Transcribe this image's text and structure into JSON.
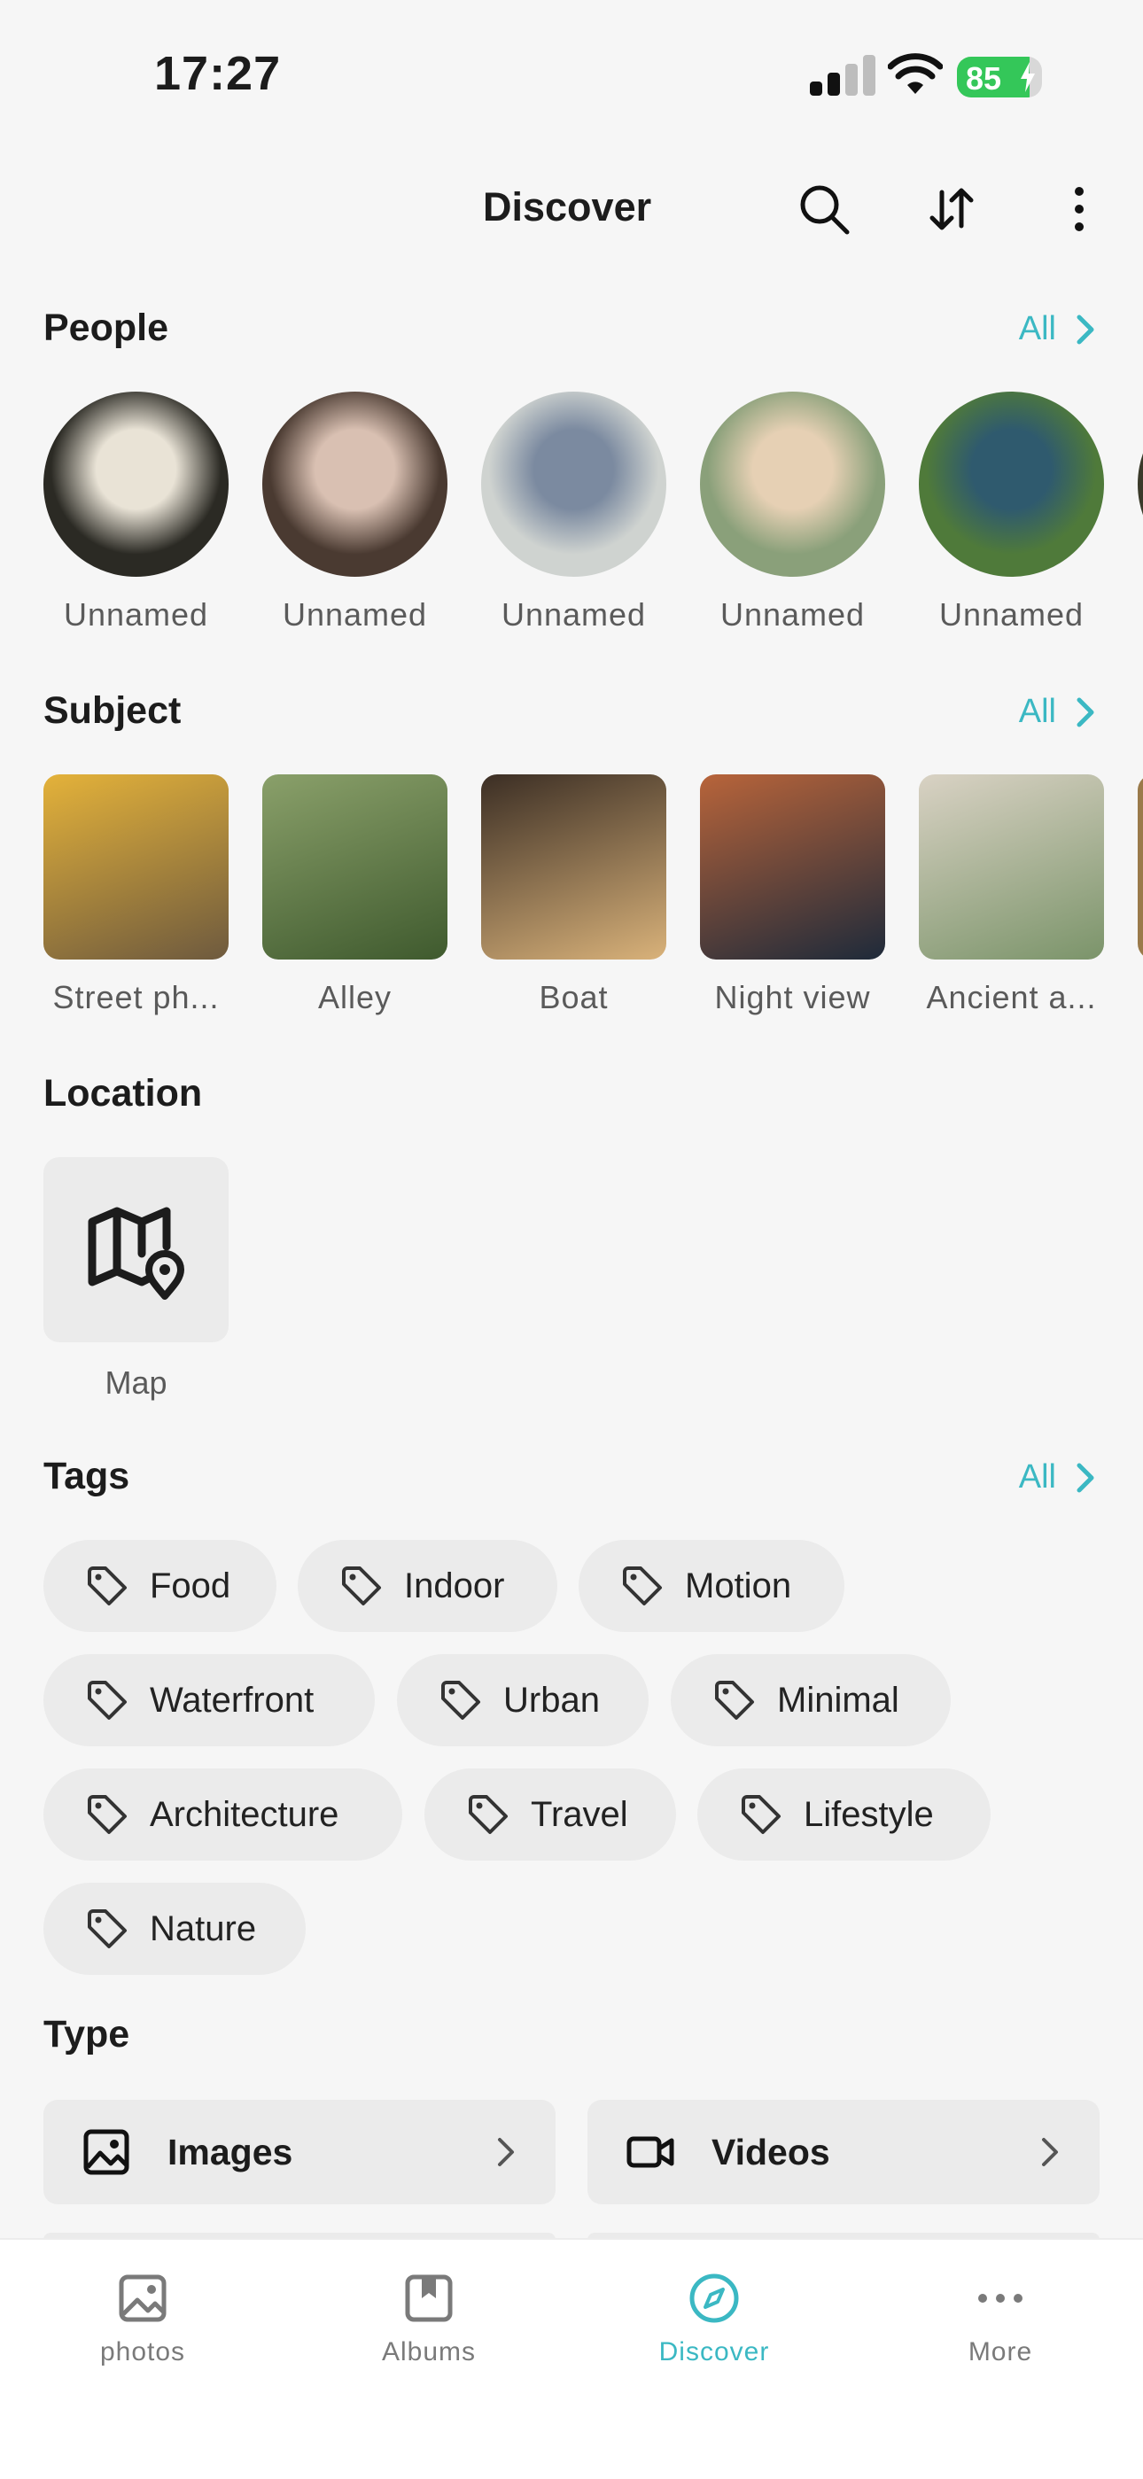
{
  "status_bar": {
    "time": "17:27",
    "battery": "85",
    "battery_level": 0.85
  },
  "header": {
    "title": "Discover",
    "icons": [
      "search-icon",
      "sort-icon",
      "more-vertical-icon"
    ]
  },
  "people": {
    "title": "People",
    "all_label": "All",
    "items": [
      {
        "name": "Unnamed",
        "colors": [
          "#2b2a24",
          "#e9e3d6"
        ]
      },
      {
        "name": "Unnamed",
        "colors": [
          "#4a3a31",
          "#d9c0b2"
        ]
      },
      {
        "name": "Unnamed",
        "colors": [
          "#cfd3d0",
          "#7b8aa0"
        ]
      },
      {
        "name": "Unnamed",
        "colors": [
          "#8aa07a",
          "#e6d0b4"
        ]
      },
      {
        "name": "Unnamed",
        "colors": [
          "#4f7a3a",
          "#2f5a6e"
        ]
      }
    ]
  },
  "subject": {
    "title": "Subject",
    "all_label": "All",
    "items": [
      {
        "label": "Street ph...",
        "colors": [
          "#6e5a3e",
          "#e4b23a"
        ]
      },
      {
        "label": "Alley",
        "colors": [
          "#3f5a2e",
          "#8aa06a"
        ]
      },
      {
        "label": "Boat",
        "colors": [
          "#d9b27a",
          "#3b2e24"
        ]
      },
      {
        "label": "Night view",
        "colors": [
          "#1e2a3a",
          "#b8643a"
        ]
      },
      {
        "label": "Ancient a...",
        "colors": [
          "#7b946a",
          "#d9d2c4"
        ]
      }
    ]
  },
  "location": {
    "title": "Location",
    "map_label": "Map"
  },
  "tags": {
    "title": "Tags",
    "all_label": "All",
    "items": [
      "Food",
      "Indoor",
      "Motion",
      "Waterfront",
      "Urban",
      "Minimal",
      "Architecture",
      "Travel",
      "Lifestyle",
      "Nature"
    ]
  },
  "type": {
    "title": "Type",
    "items": [
      {
        "label": "Images",
        "icon": "image-icon"
      },
      {
        "label": "Videos",
        "icon": "video-icon"
      }
    ]
  },
  "bottom_nav": {
    "items": [
      {
        "label": "photos",
        "icon": "photo-icon"
      },
      {
        "label": "Albums",
        "icon": "album-icon"
      },
      {
        "label": "Discover",
        "icon": "compass-icon",
        "active": true
      },
      {
        "label": "More",
        "icon": "more-horizontal-icon"
      }
    ]
  },
  "accent_color": "#3bb8c3"
}
